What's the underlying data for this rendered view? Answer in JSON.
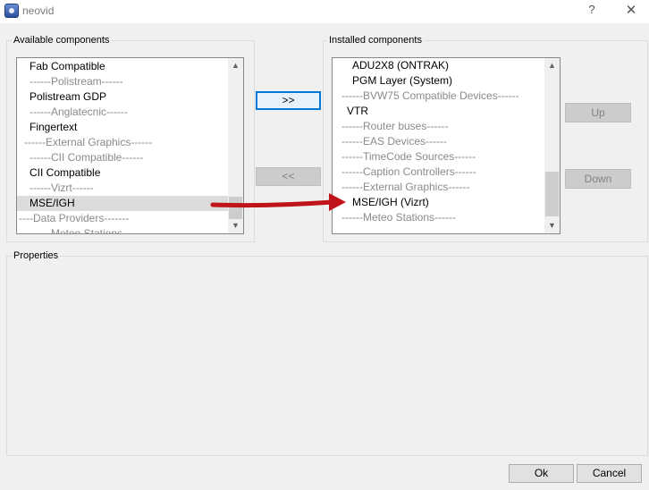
{
  "window": {
    "title": "neovid",
    "help": "?",
    "close": "✕"
  },
  "available": {
    "label": "Available components",
    "items": [
      {
        "text": "Fab Compatible",
        "type": "item",
        "indent": 14
      },
      {
        "text": "------Polistream------",
        "type": "header",
        "indent": 14
      },
      {
        "text": "Polistream GDP",
        "type": "item",
        "indent": 14
      },
      {
        "text": "------Anglatecnic------",
        "type": "header",
        "indent": 14
      },
      {
        "text": "Fingertext",
        "type": "item",
        "indent": 14
      },
      {
        "text": "------External Graphics------",
        "type": "header",
        "indent": 8
      },
      {
        "text": "------CII Compatible------",
        "type": "header",
        "indent": 14
      },
      {
        "text": "CII Compatible",
        "type": "item",
        "indent": 14
      },
      {
        "text": "------Vizrt------",
        "type": "header",
        "indent": 14
      },
      {
        "text": "MSE/IGH",
        "type": "item",
        "indent": 14,
        "selected": true
      },
      {
        "text": "----Data Providers-------",
        "type": "header",
        "indent": 2
      },
      {
        "text": "------Meteo Stations------",
        "type": "header",
        "indent": 14
      }
    ]
  },
  "installed": {
    "label": "Installed components",
    "items": [
      {
        "text": "ADU2X8 (ONTRAK)",
        "type": "item",
        "indent": 22
      },
      {
        "text": "PGM Layer (System)",
        "type": "item",
        "indent": 22
      },
      {
        "text": "------BVW75 Compatible Devices------",
        "type": "header",
        "indent": 10
      },
      {
        "text": "VTR",
        "type": "item",
        "indent": 16
      },
      {
        "text": "------Router buses------",
        "type": "header",
        "indent": 10
      },
      {
        "text": "------EAS Devices------",
        "type": "header",
        "indent": 10
      },
      {
        "text": "------TimeCode Sources------",
        "type": "header",
        "indent": 10
      },
      {
        "text": "------Caption Controllers------",
        "type": "header",
        "indent": 10
      },
      {
        "text": "------External Graphics------",
        "type": "header",
        "indent": 10
      },
      {
        "text": "MSE/IGH (Vizrt)",
        "type": "item",
        "indent": 22
      },
      {
        "text": "------Meteo Stations------",
        "type": "header",
        "indent": 10
      }
    ]
  },
  "buttons": {
    "install": ">>",
    "uninstall": "<<",
    "up": "Up",
    "down": "Down",
    "ok": "Ok",
    "cancel": "Cancel"
  },
  "properties": {
    "label": "Properties"
  },
  "colors": {
    "annotation_arrow": "#c0141a",
    "focus_border": "#0078d7"
  },
  "annotation": {
    "type": "arrow",
    "from": "available.MSE/IGH",
    "to": "installed.MSE/IGH (Vizrt)"
  }
}
